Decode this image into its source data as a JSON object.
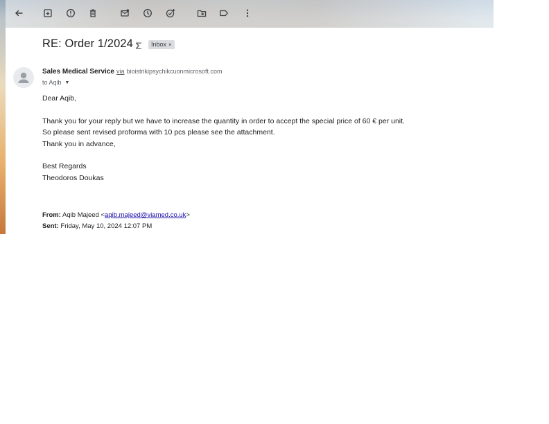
{
  "toolbar": {
    "icons": [
      "back-arrow-icon",
      "archive-icon",
      "report-spam-icon",
      "delete-icon",
      "mark-unread-icon",
      "snooze-icon",
      "add-task-icon",
      "move-to-icon",
      "label-icon",
      "more-options-icon"
    ]
  },
  "email": {
    "subject": "RE: Order 1/2024",
    "label": "Inbox",
    "label_remove": "×",
    "sender_name": "Sales Medical Service",
    "via": "via",
    "sender_domain": "bioistrikipsychikcuonmicrosoft.com",
    "recipient": "to Aqib",
    "body": {
      "greeting": "Dear Aqib,",
      "line1": "Thank you for your reply but we have to increase the quantity in order to accept the special price of 60 € per unit.",
      "line2": "So please sent revised proforma with 10 pcs please see the attachment.",
      "line3": "Thank you in advance,",
      "closing": "Best Regards",
      "signature": "Theodoros Doukas"
    },
    "quoted": {
      "from_label": "From:",
      "from_name": "Aqib Majeed",
      "from_email": "aqib.majeed@viamed.co.uk",
      "sent_label": "Sent:",
      "sent_value": "Friday, May 10, 2024 12:07 PM"
    }
  },
  "colors": {
    "label_chip": "#dadce0",
    "link": "#1a0dab",
    "icon": "#3c4043"
  }
}
